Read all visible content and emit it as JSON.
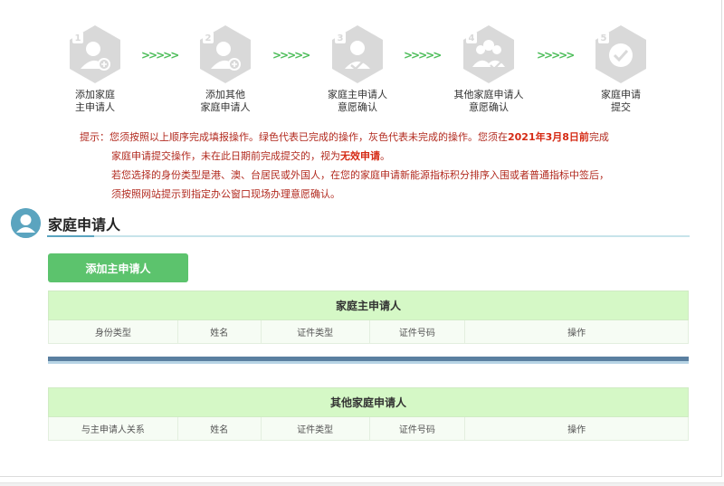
{
  "steps": [
    {
      "number": "1",
      "label_line1": "添加家庭",
      "label_line2": "主申请人",
      "icon": "person-add-icon"
    },
    {
      "number": "2",
      "label_line1": "添加其他",
      "label_line2": "家庭申请人",
      "icon": "person-add-icon"
    },
    {
      "number": "3",
      "label_line1": "家庭主申请人",
      "label_line2": "意愿确认",
      "icon": "person-check-icon"
    },
    {
      "number": "4",
      "label_line1": "其他家庭申请人",
      "label_line2": "意愿确认",
      "icon": "people-check-icon"
    },
    {
      "number": "5",
      "label_line1": "家庭申请",
      "label_line2": "提交",
      "icon": "check-circle-icon"
    }
  ],
  "arrows": ">>>>>",
  "notice": {
    "l1_a": "提示：您须按照以上顺序完成填报操作。绿色代表已完成的操作，灰色代表未完成的操作。您须在",
    "l1_b": "2021年3月8日前",
    "l1_c": "完成",
    "l2_a": "家庭申请提交操作，未在此日期前完成提交的，视为",
    "l2_b": "无效申请",
    "l2_c": "。",
    "l3": "若您选择的身份类型是港、澳、台居民或外国人，在您的家庭申请新能源指标积分排序入围或者普通指标中签后，",
    "l4": "须按照网站提示到指定办公窗口现场办理意愿确认。"
  },
  "section": {
    "title": "家庭申请人"
  },
  "add_button": "添加主申请人",
  "main_table": {
    "caption": "家庭主申请人",
    "headers": [
      "身份类型",
      "姓名",
      "证件类型",
      "证件号码",
      "操作"
    ]
  },
  "other_table": {
    "caption": "其他家庭申请人",
    "headers": [
      "与主申请人关系",
      "姓名",
      "证件类型",
      "证件号码",
      "操作"
    ]
  },
  "colors": {
    "accent_green": "#5cc36d",
    "step_gray": "#d9d9d9",
    "notice_red": "#b22a1f",
    "header_green": "#d5f8c6",
    "section_blue": "#5ba4bf"
  }
}
